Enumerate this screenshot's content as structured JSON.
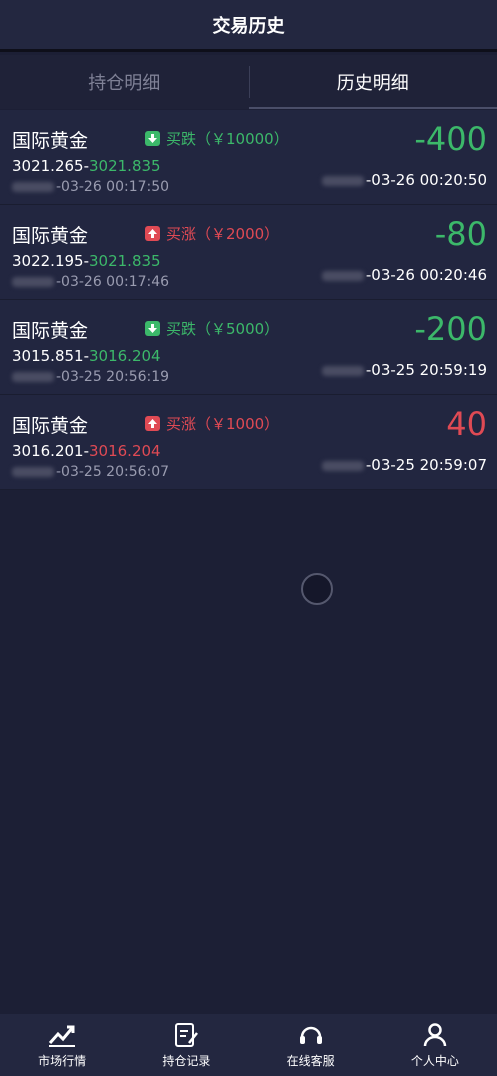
{
  "header": {
    "title": "交易历史"
  },
  "tabs": [
    {
      "label": "持仓明细",
      "active": false
    },
    {
      "label": "历史明细",
      "active": true
    }
  ],
  "records": [
    {
      "name": "国际黄金",
      "direction": "down",
      "type_label": "买跌（￥10000）",
      "open_price": "3021.265",
      "close_price": "3021.835",
      "price_color": "green",
      "open_time": "-03-26 00:17:50",
      "profit": "-400",
      "profit_color": "green",
      "close_time": "-03-26 00:20:50"
    },
    {
      "name": "国际黄金",
      "direction": "up",
      "type_label": "买涨（￥2000）",
      "open_price": "3022.195",
      "close_price": "3021.835",
      "price_color": "green",
      "open_time": "-03-26 00:17:46",
      "profit": "-80",
      "profit_color": "green",
      "close_time": "-03-26 00:20:46"
    },
    {
      "name": "国际黄金",
      "direction": "down",
      "type_label": "买跌（￥5000）",
      "open_price": "3015.851",
      "close_price": "3016.204",
      "price_color": "green",
      "open_time": "-03-25 20:56:19",
      "profit": "-200",
      "profit_color": "green",
      "close_time": "-03-25 20:59:19"
    },
    {
      "name": "国际黄金",
      "direction": "up",
      "type_label": "买涨（￥1000）",
      "open_price": "3016.201",
      "close_price": "3016.204",
      "price_color": "red",
      "open_time": "-03-25 20:56:07",
      "profit": "40",
      "profit_color": "red",
      "close_time": "-03-25 20:59:07"
    }
  ],
  "nav": [
    {
      "label": "市场行情",
      "icon": "chart-icon"
    },
    {
      "label": "持仓记录",
      "icon": "record-icon"
    },
    {
      "label": "在线客服",
      "icon": "headset-icon"
    },
    {
      "label": "个人中心",
      "icon": "user-icon"
    }
  ],
  "colors": {
    "green": "#3cb86a",
    "red": "#e04a54",
    "background": "#1c1f35",
    "header": "#232740"
  }
}
